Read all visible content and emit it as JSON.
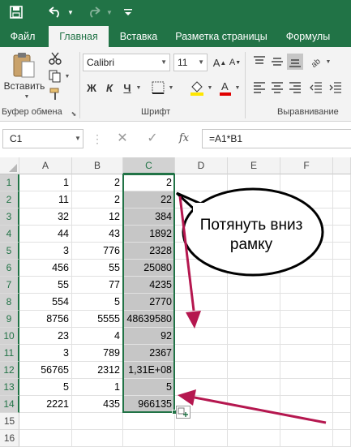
{
  "quick_access": {
    "save_icon": "save-icon",
    "undo_icon": "undo-icon",
    "redo_icon": "redo-icon",
    "customize_icon": "customize-icon"
  },
  "tabs": [
    {
      "label": "Файл",
      "active": false
    },
    {
      "label": "Главная",
      "active": true
    },
    {
      "label": "Вставка",
      "active": false
    },
    {
      "label": "Разметка страницы",
      "active": false
    },
    {
      "label": "Формулы",
      "active": false
    }
  ],
  "ribbon": {
    "clipboard": {
      "paste_label": "Вставить",
      "group_label": "Буфер обмена"
    },
    "font": {
      "name": "Calibri",
      "size": "11",
      "bold": "Ж",
      "italic": "К",
      "underline": "Ч",
      "group_label": "Шрифт"
    },
    "alignment": {
      "group_label": "Выравнивание"
    }
  },
  "formula_bar": {
    "name_box": "C1",
    "fx": "fx",
    "formula": "=A1*B1"
  },
  "columns": [
    "A",
    "B",
    "C",
    "D",
    "E",
    "F"
  ],
  "selected_column": "C",
  "rows": [
    {
      "n": "1",
      "a": "1",
      "b": "2",
      "c": "2"
    },
    {
      "n": "2",
      "a": "11",
      "b": "2",
      "c": "22"
    },
    {
      "n": "3",
      "a": "32",
      "b": "12",
      "c": "384"
    },
    {
      "n": "4",
      "a": "44",
      "b": "43",
      "c": "1892"
    },
    {
      "n": "5",
      "a": "3",
      "b": "776",
      "c": "2328"
    },
    {
      "n": "6",
      "a": "456",
      "b": "55",
      "c": "25080"
    },
    {
      "n": "7",
      "a": "55",
      "b": "77",
      "c": "4235"
    },
    {
      "n": "8",
      "a": "554",
      "b": "5",
      "c": "2770"
    },
    {
      "n": "9",
      "a": "8756",
      "b": "5555",
      "c": "48639580"
    },
    {
      "n": "10",
      "a": "23",
      "b": "4",
      "c": "92"
    },
    {
      "n": "11",
      "a": "3",
      "b": "789",
      "c": "2367"
    },
    {
      "n": "12",
      "a": "56765",
      "b": "2312",
      "c": "1,31E+08"
    },
    {
      "n": "13",
      "a": "5",
      "b": "1",
      "c": "5"
    },
    {
      "n": "14",
      "a": "2221",
      "b": "435",
      "c": "966135"
    },
    {
      "n": "15",
      "a": "",
      "b": "",
      "c": ""
    },
    {
      "n": "16",
      "a": "",
      "b": "",
      "c": ""
    }
  ],
  "annotation": {
    "callout_text": "Потянуть вниз рамку",
    "arrow_color": "#b5174f"
  },
  "colors": {
    "accent": "#217346",
    "selection": "#c6c6c6"
  }
}
